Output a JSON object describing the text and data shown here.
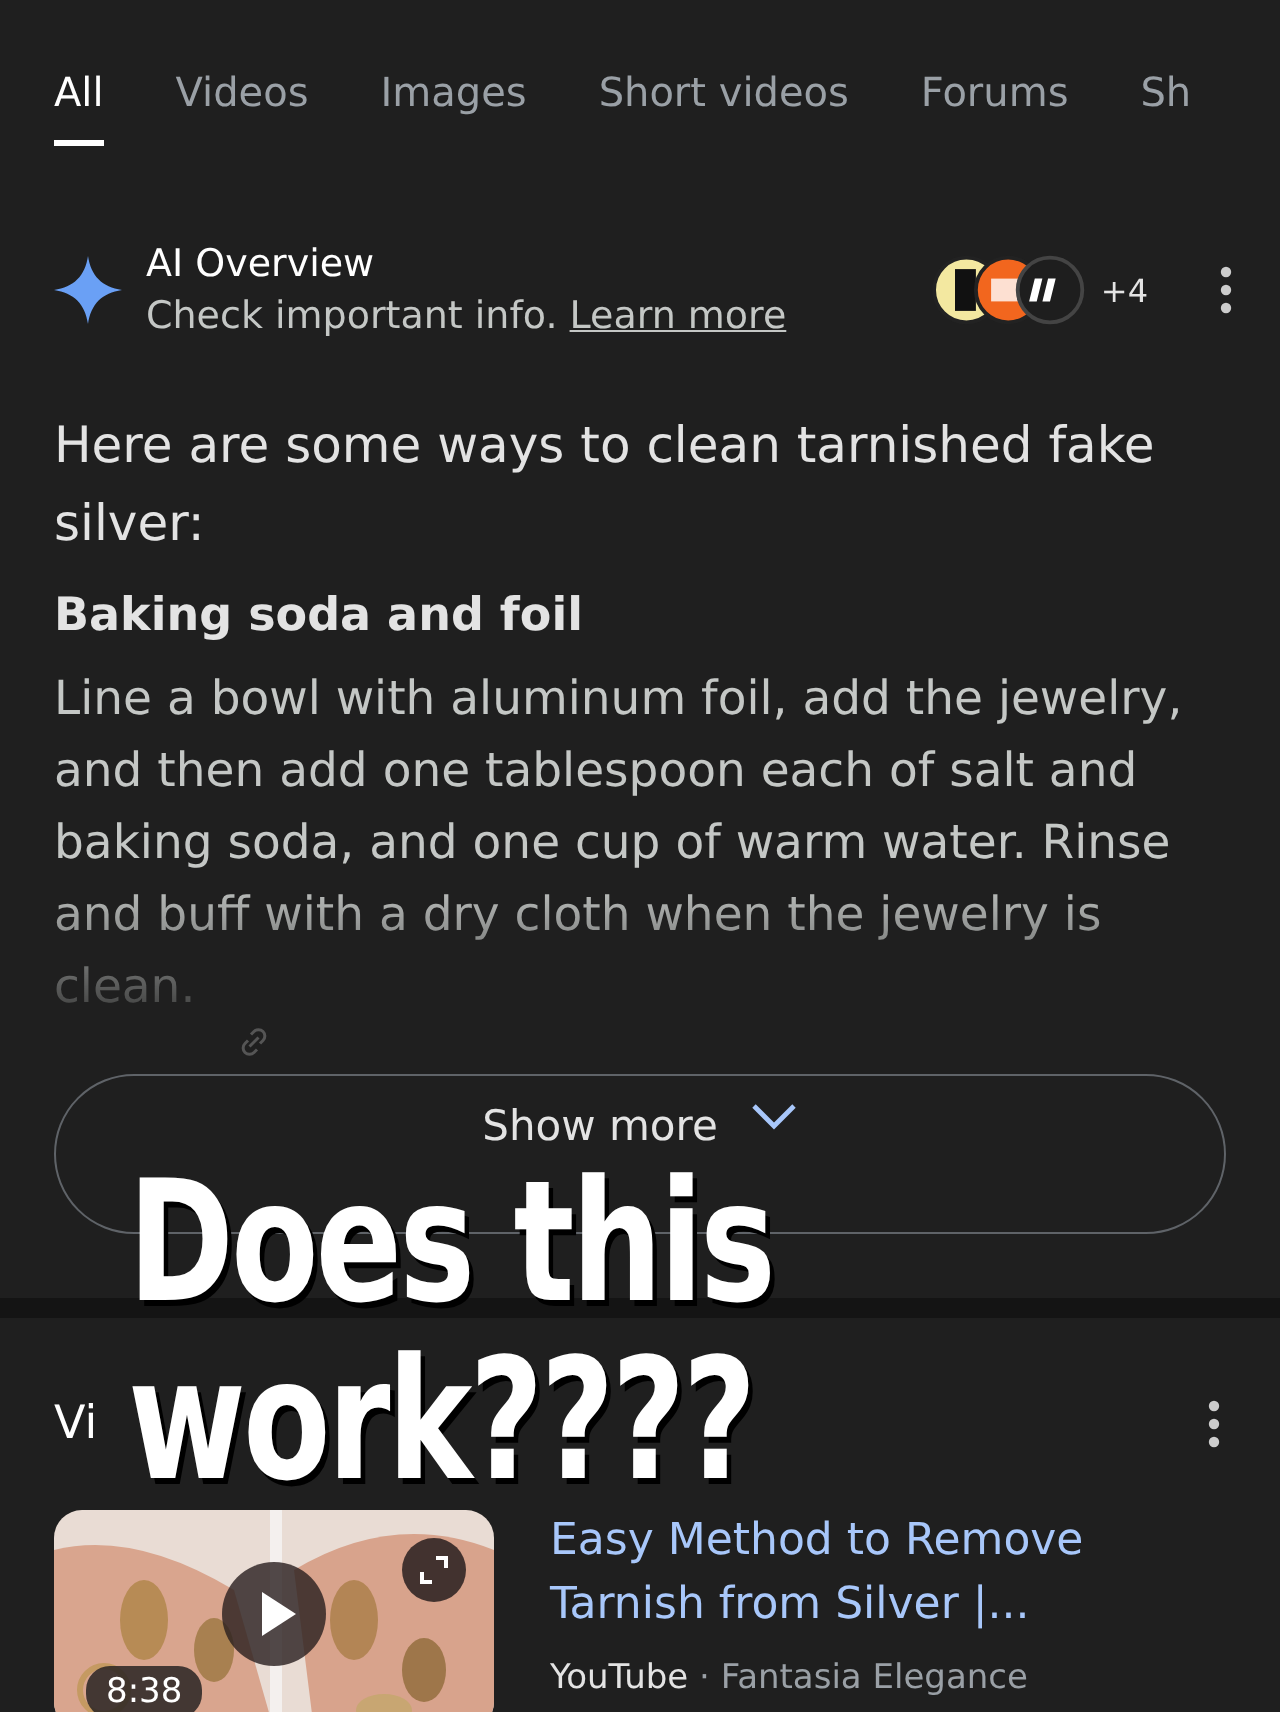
{
  "tabs": [
    {
      "label": "All",
      "selected": true
    },
    {
      "label": "Videos",
      "selected": false
    },
    {
      "label": "Images",
      "selected": false
    },
    {
      "label": "Short videos",
      "selected": false
    },
    {
      "label": "Forums",
      "selected": false
    },
    {
      "label": "Sh",
      "selected": false
    }
  ],
  "ai_overview": {
    "title": "AI Overview",
    "subtitle": "Check important info.",
    "link": "Learn more",
    "source_count": "+4",
    "intro": "Here are some ways to clean tarnished fake silver:",
    "heading": "Baking soda and foil",
    "body": "Line a bowl with aluminum foil, add the jewelry, and then add one tablespoon each of salt and baking soda, and one cup of warm water. Rinse and buff with a dry cloth when the jewelry is clean.",
    "show_more": "Show more"
  },
  "videos": {
    "title": "Vi",
    "items": [
      {
        "kind": "picture",
        "duration": "8:38",
        "title": "Easy Method to Remove Tarnish from Silver |...",
        "platform": "YouTube",
        "separator": "·",
        "channel": "Fantasia Elegance"
      }
    ]
  },
  "caption": "Does this work????"
}
